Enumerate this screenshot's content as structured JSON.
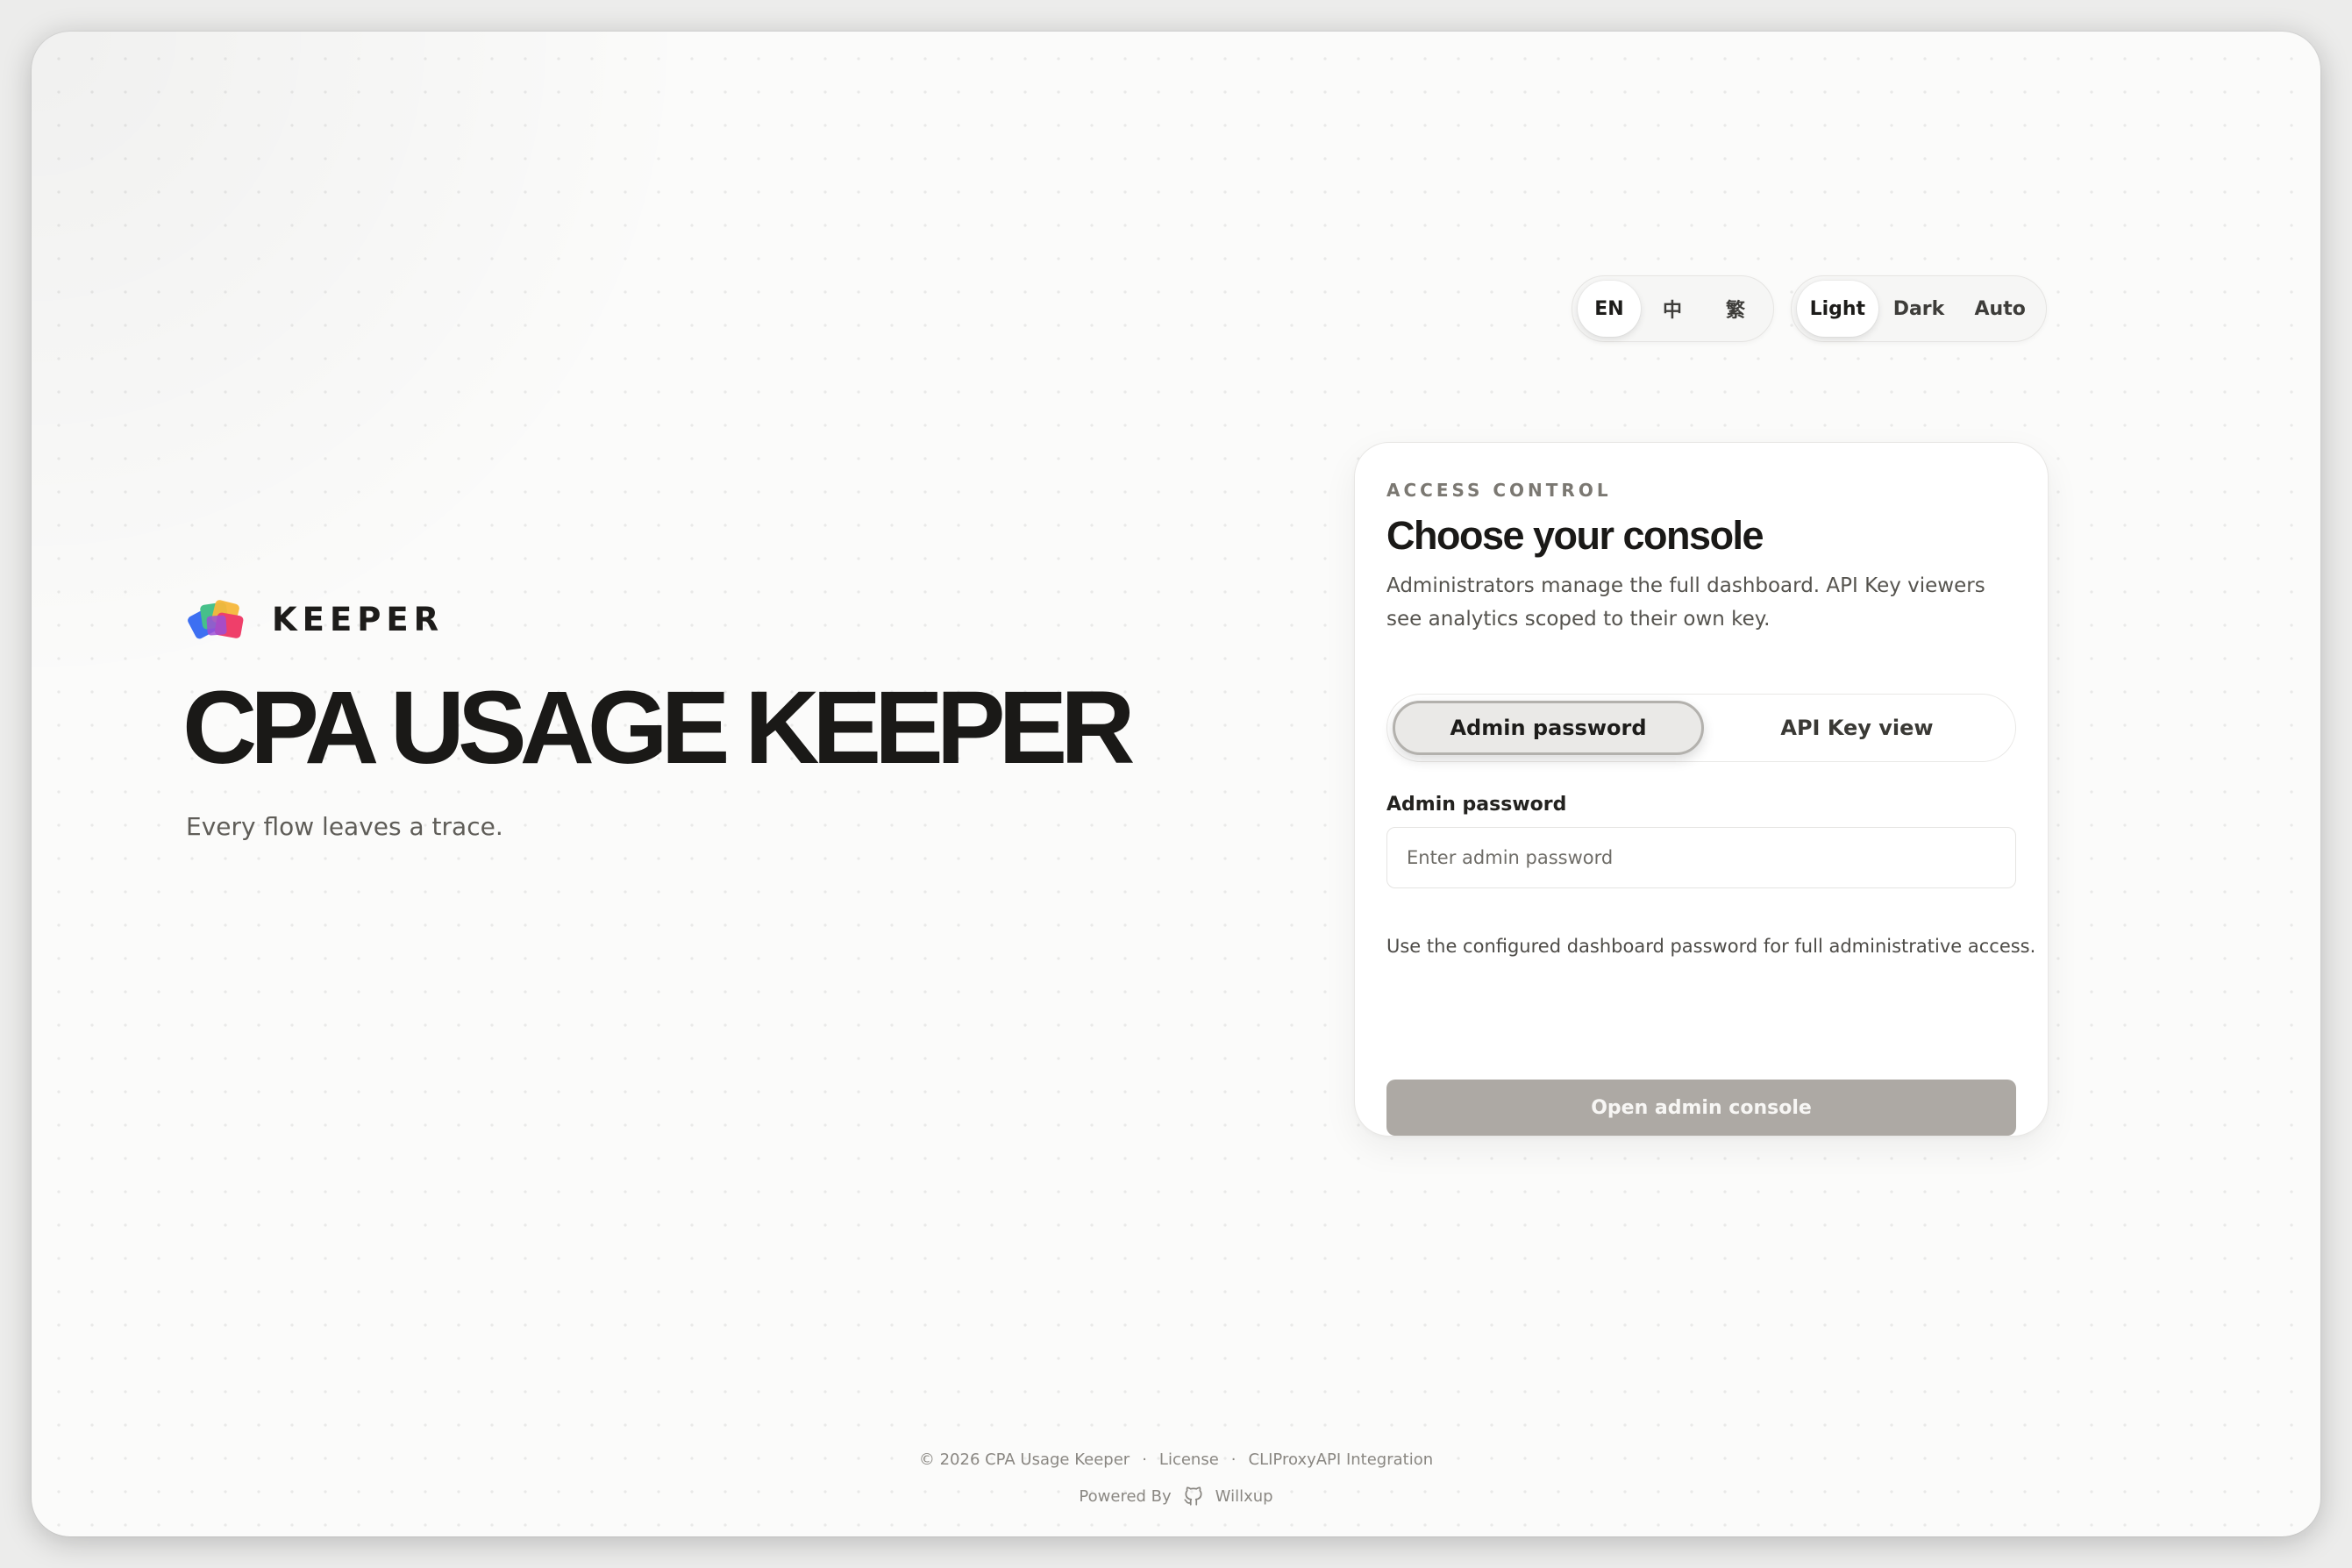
{
  "header": {
    "languages": [
      {
        "label": "EN",
        "active": true
      },
      {
        "label": "中",
        "active": false
      },
      {
        "label": "繁",
        "active": false
      }
    ],
    "themes": [
      {
        "label": "Light",
        "active": true
      },
      {
        "label": "Dark",
        "active": false
      },
      {
        "label": "Auto",
        "active": false
      }
    ]
  },
  "hero": {
    "brand_name": "KEEPER",
    "title": "CPA USAGE KEEPER",
    "subtitle": "Every flow leaves a trace.",
    "logo_icon": "layered-color-cards-logo"
  },
  "card": {
    "eyebrow": "ACCESS CONTROL",
    "title": "Choose your console",
    "description": "Administrators manage the full dashboard. API Key viewers see analytics scoped to their own key.",
    "tabs": [
      {
        "label": "Admin password",
        "active": true
      },
      {
        "label": "API Key view",
        "active": false
      }
    ],
    "field_label": "Admin password",
    "field_placeholder": "Enter admin password",
    "field_value": "",
    "helper": "Use the configured dashboard password for full administrative access.",
    "submit_label": "Open admin console"
  },
  "footer": {
    "copyright": "© 2026  CPA Usage Keeper",
    "separator": "·",
    "license": "License",
    "integration": "CLIProxyAPI Integration",
    "powered_by": "Powered By",
    "author": "Willxup",
    "author_icon": "github-icon"
  },
  "colors": {
    "background": "#fbfbfa",
    "text": "#1a1917",
    "submit_disabled": "#ada9a4",
    "accent_active": "#eae9e7"
  }
}
